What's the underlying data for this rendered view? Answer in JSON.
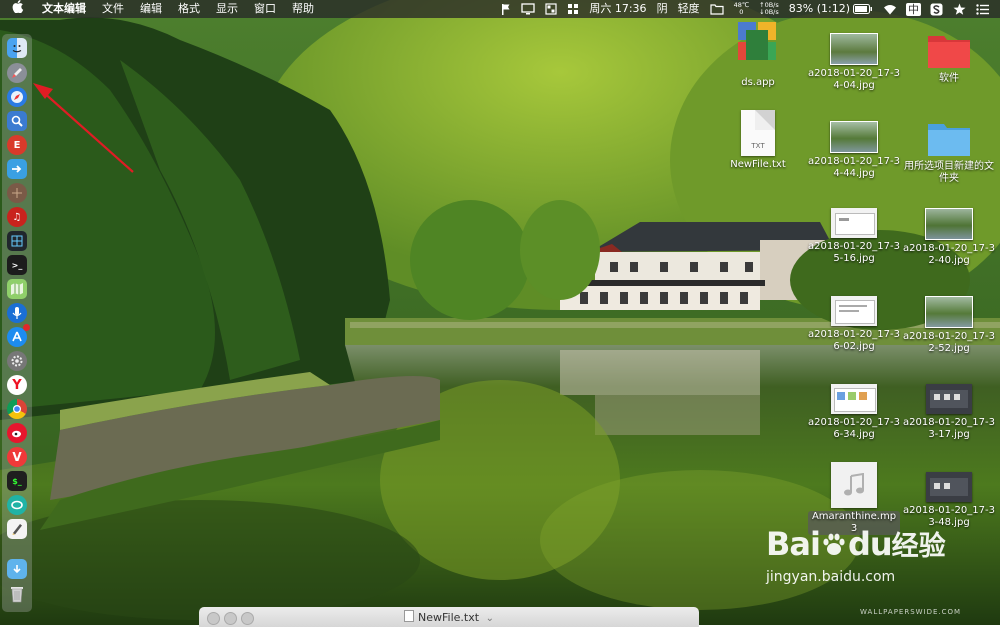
{
  "menubar": {
    "apple_icon": "apple-icon",
    "app_name": "文本编辑",
    "menus": [
      "文件",
      "编辑",
      "格式",
      "显示",
      "窗口",
      "帮助"
    ],
    "status": {
      "temperature_top": "48℃",
      "temperature_bottom": "0",
      "net_up": "↑0B/s",
      "net_down": "↓0B/s",
      "battery": "83% (1:12)",
      "input_method": "中",
      "datetime": "周六 17:36",
      "weather": "阴",
      "air": "轻度"
    }
  },
  "dock": {
    "icons": [
      "finder-icon",
      "launchpad-icon",
      "safari-icon",
      "preview-icon",
      "app-icon-red",
      "migration-icon",
      "ball-icon",
      "netease-music-icon",
      "grid-app-icon",
      "terminal-icon",
      "maps-icon",
      "siri-icon",
      "app-store-icon",
      "system-preferences-icon",
      "yandex-icon",
      "chrome-icon",
      "weibo-icon",
      "vivaldi-icon",
      "terminal2-icon",
      "mail-icon",
      "textedit-icon",
      "downloads-folder-icon",
      "trash-icon"
    ]
  },
  "desktop": {
    "items": [
      {
        "name": "ds.app",
        "type": "app"
      },
      {
        "name": "软件",
        "type": "folder-red"
      },
      {
        "name": "a2018-01-20_17-34-04.jpg",
        "type": "photo"
      },
      {
        "name": "NewFile.txt",
        "type": "txt",
        "badge": "TXT"
      },
      {
        "name": "a2018-01-20_17-34-44.jpg",
        "type": "photo"
      },
      {
        "name": "用所选项目新建的文件夹",
        "type": "folder-blue"
      },
      {
        "name": "a2018-01-20_17-35-16.jpg",
        "type": "screen"
      },
      {
        "name": "a2018-01-20_17-32-40.jpg",
        "type": "photo"
      },
      {
        "name": "a2018-01-20_17-36-02.jpg",
        "type": "screen"
      },
      {
        "name": "a2018-01-20_17-32-52.jpg",
        "type": "photo"
      },
      {
        "name": "a2018-01-20_17-36-34.jpg",
        "type": "screen"
      },
      {
        "name": "a2018-01-20_17-33-17.jpg",
        "type": "dark"
      },
      {
        "name": "Amaranthine.mp3",
        "type": "mp3"
      },
      {
        "name": "a2018-01-20_17-33-48.jpg",
        "type": "dark"
      }
    ]
  },
  "window": {
    "title": "NewFile.txt",
    "chevron": "⌄"
  },
  "watermark": {
    "baidu_text": "Bai",
    "baidu_paw": "du",
    "baidu_cn": "经验",
    "baidu_url": "jingyan.baidu.com",
    "wallpaper_site": "WALLPAPERSWIDE.COM"
  },
  "annotation": {
    "arrow_color": "#e01c24",
    "target": "launchpad-icon"
  }
}
